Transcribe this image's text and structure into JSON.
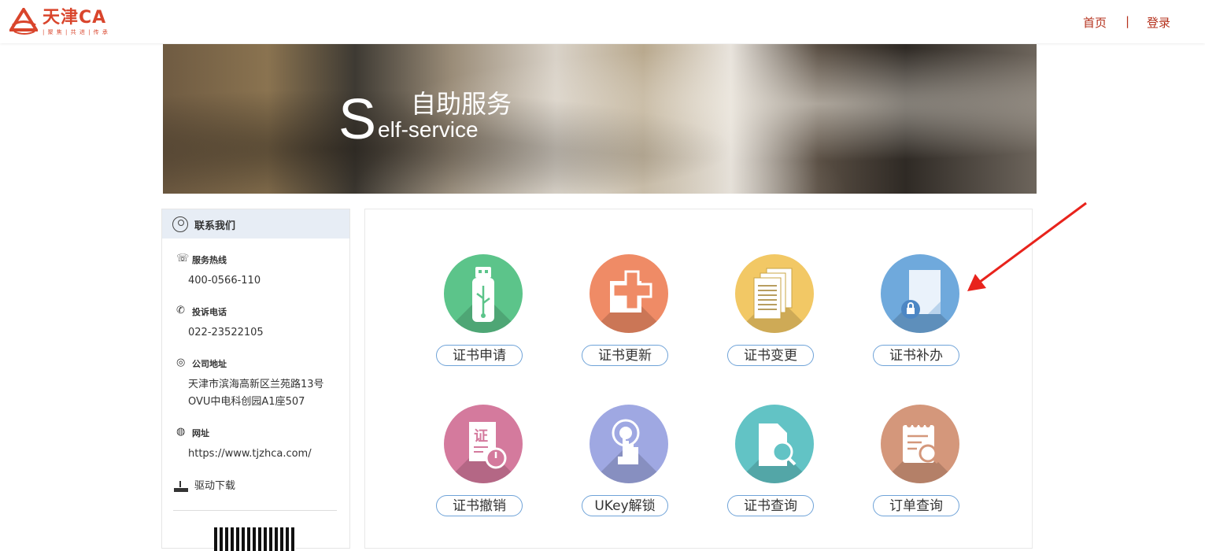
{
  "header": {
    "logo_name": "天津CA",
    "logo_tagline": "| 聚 焦 | 共 进 | 传 承",
    "nav_home": "首页",
    "nav_sep": "|",
    "nav_login": "登录"
  },
  "banner": {
    "big_letter": "S",
    "title": "自助服务",
    "subtitle": "elf-service"
  },
  "sidebar": {
    "title": "联系我们",
    "hotline_label": "服务热线",
    "hotline_value": "400-0566-110",
    "complaint_label": "投诉电话",
    "complaint_value": "022-23522105",
    "address_label": "公司地址",
    "address_line1": "天津市滨海高新区兰苑路13号",
    "address_line2": "OVU中电科创园A1座507",
    "website_label": "网址",
    "website_value": "https://www.tjzhca.com/",
    "driver_label": "驱动下载"
  },
  "services": [
    {
      "label": "证书申请",
      "icon": "usb-icon",
      "color": "#5cc48a"
    },
    {
      "label": "证书更新",
      "icon": "cross-icon",
      "color": "#ef8b66"
    },
    {
      "label": "证书变更",
      "icon": "documents-icon",
      "color": "#f2c865"
    },
    {
      "label": "证书补办",
      "icon": "locked-document-icon",
      "color": "#6fa9dc"
    },
    {
      "label": "证书撤销",
      "icon": "certificate-power-icon",
      "color": "#d47a9d"
    },
    {
      "label": "UKey解锁",
      "icon": "touch-icon",
      "color": "#9fa8e2"
    },
    {
      "label": "证书查询",
      "icon": "search-document-icon",
      "color": "#62c3c5"
    },
    {
      "label": "订单查询",
      "icon": "order-search-icon",
      "color": "#d4977b"
    }
  ],
  "colors": {
    "brand_red": "#d9452c",
    "nav_red": "#b5321d",
    "pill_border": "#6fa3d8",
    "sidebar_head_bg": "#e7edf5",
    "annotation_arrow": "#e8231c"
  }
}
